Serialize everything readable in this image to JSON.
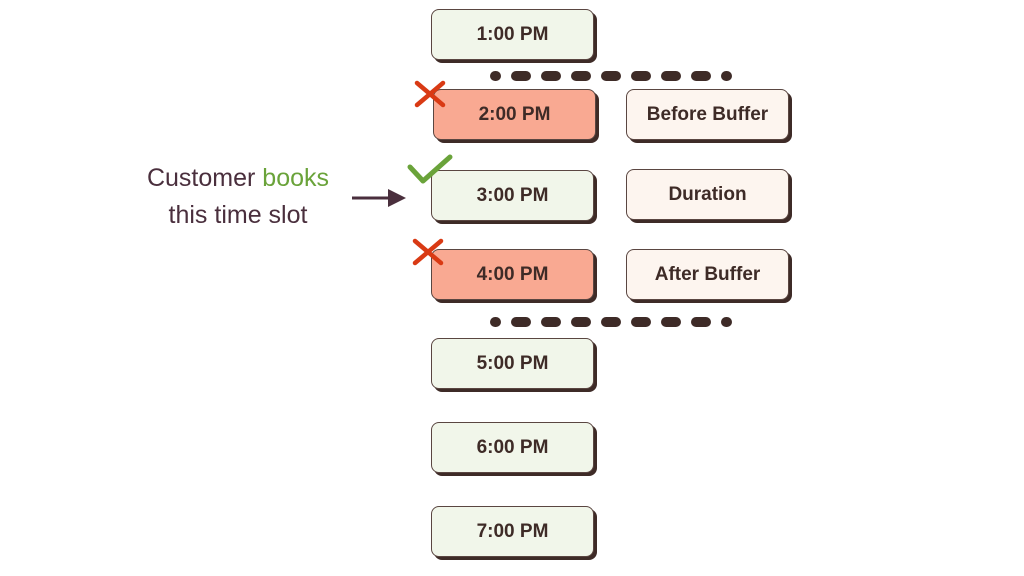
{
  "caption": {
    "line1_prefix": "Customer",
    "line1_highlight": "books",
    "line2": "this time slot"
  },
  "colors": {
    "text_dark": "#3e2b27",
    "caption_text": "#4a2f3d",
    "highlight_green": "#6aa33a",
    "cross_red": "#d93a14",
    "slot_free_fill": "#f1f6ea",
    "slot_blocked_fill": "#f9a992",
    "buffer_fill": "#fdf5ef"
  },
  "slots": [
    {
      "label": "1:00 PM",
      "status": "available"
    },
    {
      "label": "2:00 PM",
      "status": "blocked"
    },
    {
      "label": "3:00 PM",
      "status": "booked"
    },
    {
      "label": "4:00 PM",
      "status": "blocked"
    },
    {
      "label": "5:00 PM",
      "status": "available"
    },
    {
      "label": "6:00 PM",
      "status": "available"
    },
    {
      "label": "7:00 PM",
      "status": "available"
    }
  ],
  "segments": [
    {
      "label": "Before Buffer"
    },
    {
      "label": "Duration"
    },
    {
      "label": "After Buffer"
    }
  ]
}
